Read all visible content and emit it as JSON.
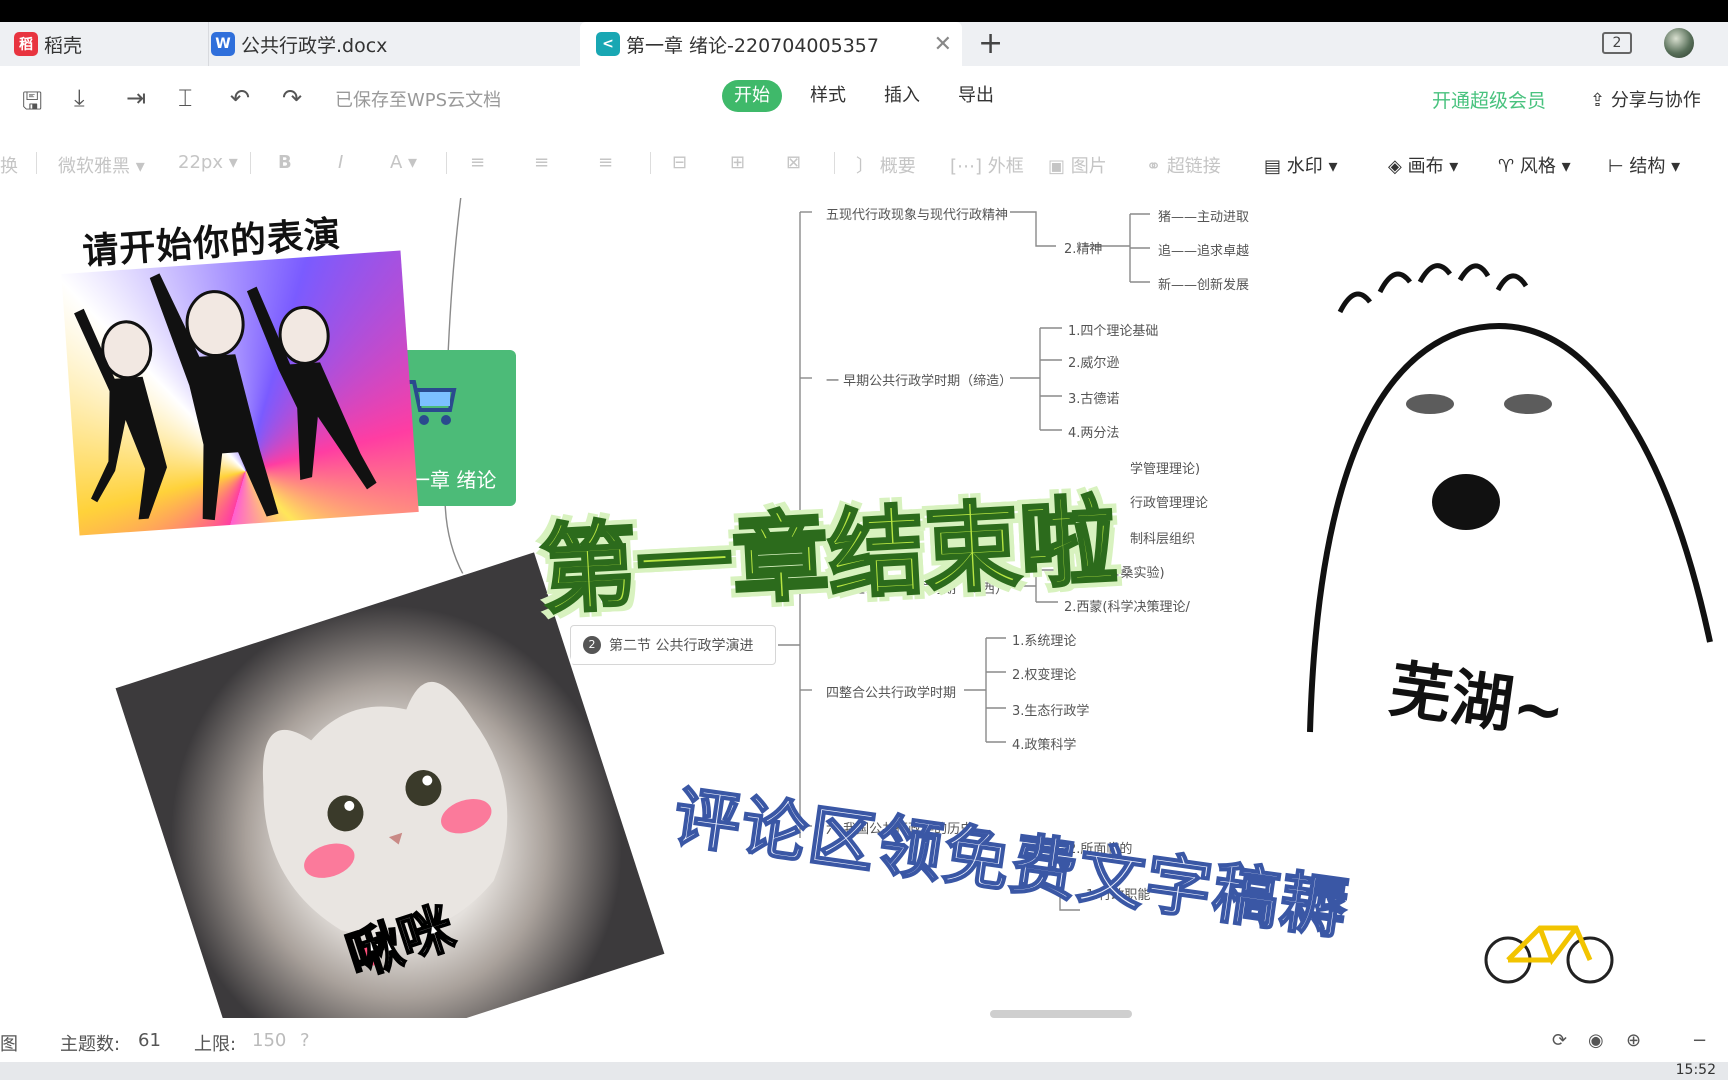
{
  "tabs": [
    {
      "label": "稻壳",
      "icon": "docer-icon",
      "color": "#e8343f"
    },
    {
      "label": "公共行政学.docx",
      "icon": "word-doc-icon",
      "color": "#2f6fdb"
    },
    {
      "label": "第一章 绪论-220704005357",
      "icon": "mindmap-icon",
      "color": "#19a7b3"
    }
  ],
  "window": {
    "badge": "2"
  },
  "toolbar": {
    "saved_status": "已保存至WPS云文档",
    "menus": [
      "开始",
      "样式",
      "插入",
      "导出"
    ],
    "active_menu": "开始",
    "vip": "开通超级会员",
    "share": "分享与协作"
  },
  "format": {
    "cut_label": "换",
    "font": "微软雅黑",
    "size": "22px",
    "bold": "B",
    "italic": "I",
    "color": "A",
    "summary": "概要",
    "frame": "外框",
    "image": "图片",
    "link": "超链接",
    "watermark": "水印",
    "canvas": "画布",
    "style": "风格",
    "structure": "结构"
  },
  "mindmap": {
    "root": "一章 绪论",
    "section2": "第二节 公共行政学演进",
    "section2_num": "2",
    "nodes": {
      "modern": "五现代行政现象与现代行政精神",
      "spirit": "2.精神",
      "s1": "猪——主动进取",
      "s2": "追——追求卓越",
      "s3": "新——创新发展",
      "early": "一 早期公共行政学时期（缔造）",
      "e1": "1.四个理论基础",
      "e2": "2.威尔逊",
      "e3": "3.古德诺",
      "e4": "4.两分法",
      "m1": "学管理理论)",
      "m2": "行政管理理论",
      "m3": "制科层组织",
      "revise": "三修正公共行政学时期（梅西）",
      "r1": "1.梅奥(霍桑实验)",
      "r2": "2.西蒙(科学决策理论/",
      "integrate": "四整合公共行政学时期",
      "i1": "1.系统理论",
      "i2": "2.权变理论",
      "i3": "3.生态行政学",
      "i4": "4.政策科学",
      "china": "六 我国公共行政学的历史",
      "c2": "2.所面临的",
      "f1": "1.行政职能"
    }
  },
  "stickers": {
    "dance_caption": "请开始你的表演",
    "big_title": "第一章结束啦",
    "ghost_caption": "芜湖~",
    "cat_caption": "啾咪",
    "comment": "评论区领免费文字稿耨"
  },
  "status": {
    "map_label": "图",
    "topics_label": "主题数:",
    "topics": "61",
    "limit_label": "上限:",
    "limit": "150",
    "time": "15:52"
  },
  "colors": {
    "accent": "#3fb96a",
    "vip": "#48c27e",
    "root_node": "#4cbb78",
    "title_fill": "#b8e642",
    "comment_stroke": "#3a57a5"
  }
}
